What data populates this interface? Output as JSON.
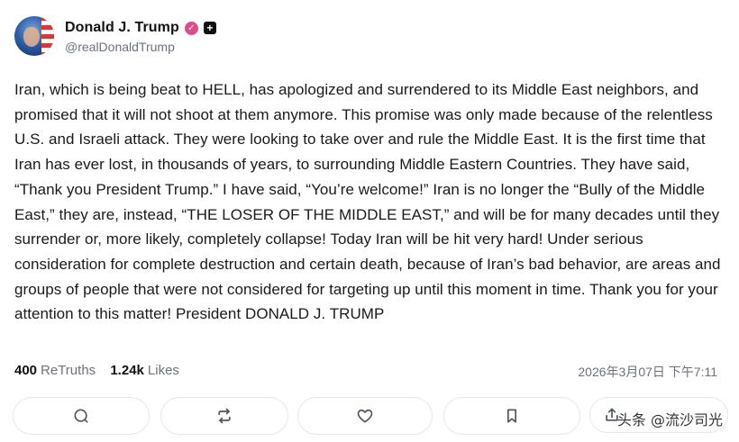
{
  "post": {
    "display_name": "Donald J. Trump",
    "handle": "@realDonaldTrump",
    "verified_icon": "verified-badge-icon",
    "plus_icon": "plus-badge-icon",
    "text": "Iran, which is being beat to HELL, has apologized and surrendered to its Middle East neighbors, and promised that it will not shoot at them anymore. This promise was only made because of the relentless U.S. and Israeli attack. They were looking to take over and rule the Middle East. It is the first time that Iran has ever lost, in thousands of years, to surrounding Middle Eastern Countries. They have said, “Thank you President Trump.” I have said, “You’re welcome!” Iran is no longer the “Bully of the Middle East,” they are, instead, “THE LOSER OF THE MIDDLE EAST,” and will be for many decades until they surrender or, more likely, completely collapse! Today Iran will be hit very hard! Under serious consideration for complete destruction and certain death, because of Iran’s bad behavior, are areas and groups of people that were not considered for targeting up until this moment in time. Thank you for your attention to this matter! President DONALD J. TRUMP"
  },
  "stats": {
    "retruths_count": "400",
    "retruths_label": "ReTruths",
    "likes_count": "1.24k",
    "likes_label": "Likes",
    "timestamp": "2026年3月07日 下午7:11"
  },
  "actions": [
    {
      "icon": "reply-icon"
    },
    {
      "icon": "retruth-icon"
    },
    {
      "icon": "like-heart-icon"
    },
    {
      "icon": "bookmark-icon"
    },
    {
      "icon": "share-icon"
    }
  ],
  "watermark": "头条 @流沙司光",
  "colors": {
    "verified": "#e24b8a",
    "muted_text": "#6b7280",
    "border": "#e5e7eb"
  }
}
